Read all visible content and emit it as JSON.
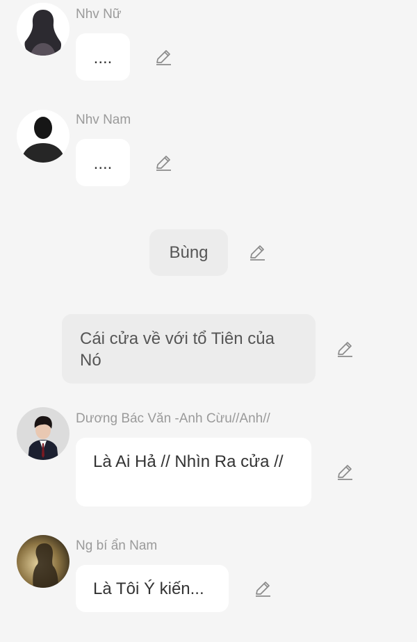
{
  "messages": [
    {
      "type": "character",
      "name": "Nhv Nữ",
      "text": "...."
    },
    {
      "type": "character",
      "name": "Nhv Nam",
      "text": "...."
    },
    {
      "type": "sound",
      "text": "Bùng"
    },
    {
      "type": "narration",
      "text": "Cái cửa về với tổ Tiên của Nó"
    },
    {
      "type": "character",
      "name": "Dương Bác Văn -Anh Cừu//Anh//",
      "text": "Là Ai Hả // Nhìn Ra cửa //"
    },
    {
      "type": "character",
      "name": "Ng bí ẩn Nam",
      "text": "Là Tôi Ý kiến..."
    }
  ],
  "icons": {
    "edit": "edit-pencil-icon"
  },
  "colors": {
    "background": "#f5f5f5",
    "bubble": "#ffffff",
    "narration_bubble": "#ececec",
    "name_text": "#9a9a9a"
  }
}
